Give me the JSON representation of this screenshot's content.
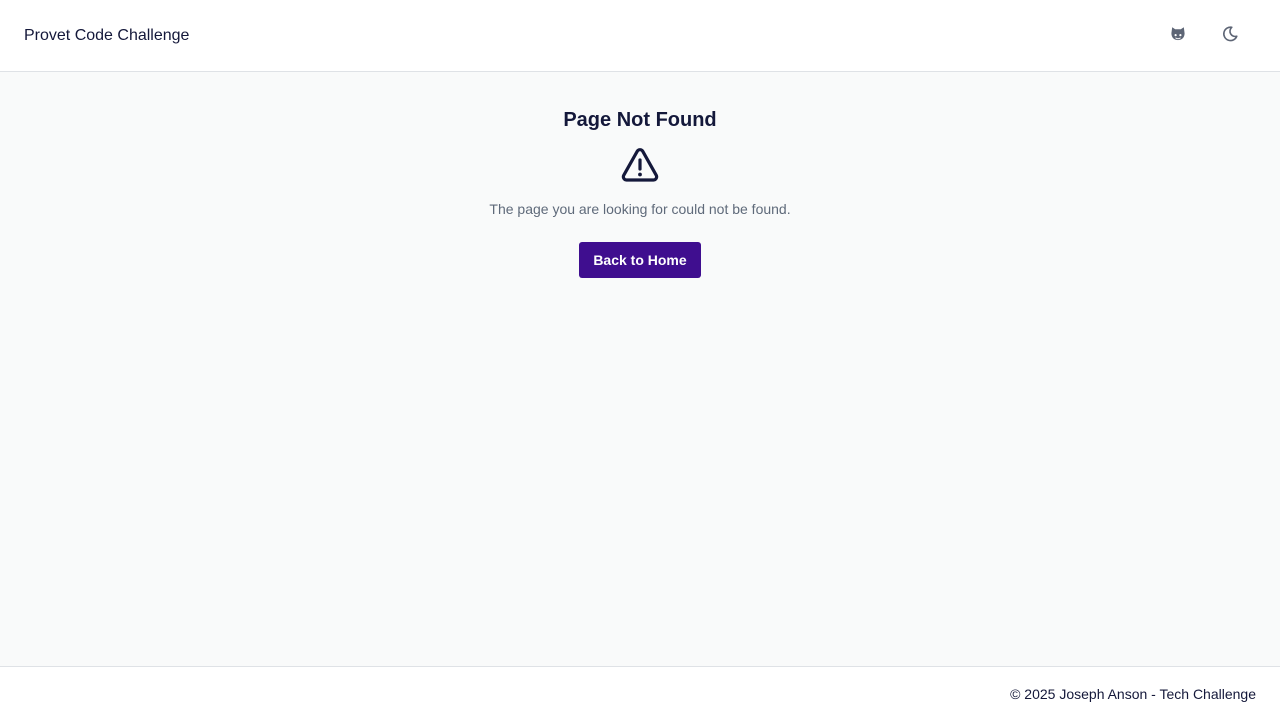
{
  "header": {
    "title": "Provet Code Challenge",
    "github_icon": "github-icon",
    "theme_icon": "moon-icon"
  },
  "main": {
    "title": "Page Not Found",
    "icon": "warning-triangle-icon",
    "message": "The page you are looking for could not be found.",
    "button_label": "Back to Home"
  },
  "footer": {
    "copyright": "© 2025 Joseph Anson - Tech Challenge"
  },
  "colors": {
    "background": "#f9fafa",
    "surface": "#ffffff",
    "text": "#14183a",
    "muted_text": "#5f6a7a",
    "primary": "#3f0e8f",
    "border": "#dfe2e6"
  }
}
